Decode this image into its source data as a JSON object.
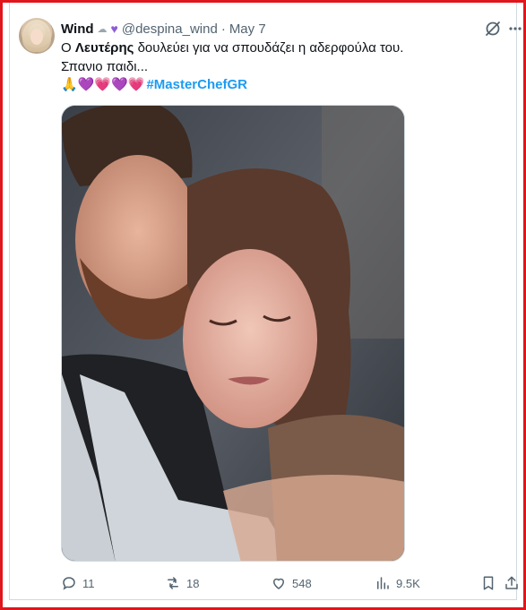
{
  "tweet": {
    "author_name": "Wind",
    "handle": "@despina_wind",
    "separator": "·",
    "date": "May 7",
    "text_before": "Ο ",
    "text_bold": "Λευτέρης",
    "text_after": " δουλεύει για να σπουδάζει η αδερφούλα του.",
    "text_line2": "Σπανιο παιδι...",
    "emojis": [
      "🙏",
      "💜",
      "💗",
      "💜",
      "💗"
    ],
    "hashtag": "#MasterChefGR"
  },
  "actions": {
    "reply_count": "11",
    "retweet_count": "18",
    "like_count": "548",
    "views_count": "9.5K"
  },
  "colors": {
    "frame_border": "#e0161c",
    "link": "#1d9bf0",
    "muted": "#536471"
  },
  "icons": [
    "grok-icon",
    "more-icon",
    "reply-icon",
    "retweet-icon",
    "like-icon",
    "views-icon",
    "bookmark-icon",
    "share-icon"
  ]
}
